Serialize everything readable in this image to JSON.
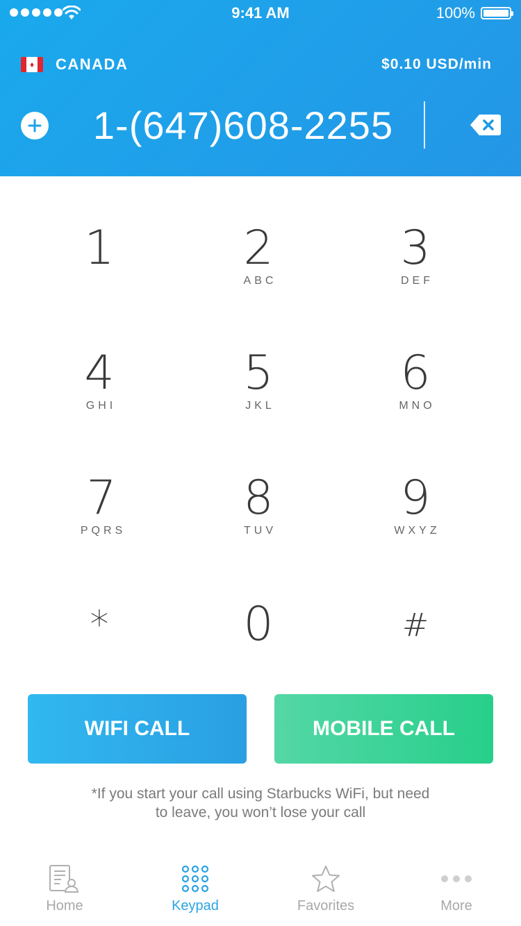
{
  "status_bar": {
    "time": "9:41 AM",
    "battery": "100%"
  },
  "header": {
    "country": "CANADA",
    "rate": "$0.10 USD/min",
    "phone_number": "1-(647)608-2255",
    "flag_icon": "canada-flag-icon",
    "add_icon": "plus-circle-icon",
    "backspace_icon": "backspace-icon",
    "colors": {
      "header_start": "#1aa9ec",
      "header_end": "#2496e6"
    }
  },
  "keypad": {
    "keys": [
      {
        "digit": "1",
        "letters": ""
      },
      {
        "digit": "2",
        "letters": "ABC"
      },
      {
        "digit": "3",
        "letters": "DEF"
      },
      {
        "digit": "4",
        "letters": "GHI"
      },
      {
        "digit": "5",
        "letters": "JKL"
      },
      {
        "digit": "6",
        "letters": "MNO"
      },
      {
        "digit": "7",
        "letters": "PQRS"
      },
      {
        "digit": "8",
        "letters": "TUV"
      },
      {
        "digit": "9",
        "letters": "WXYZ"
      },
      {
        "digit": "*",
        "letters": ""
      },
      {
        "digit": "0",
        "letters": ""
      },
      {
        "digit": "#",
        "letters": ""
      }
    ]
  },
  "actions": {
    "wifi_call": "WIFI CALL",
    "mobile_call": "MOBILE CALL",
    "colors": {
      "wifi": "#2fb2ee",
      "mobile": "#3cd49a"
    }
  },
  "note_line1": "*If you start your call using Starbucks WiFi, but need",
  "note_line2": "to leave, you won’t lose your call",
  "tabs": [
    {
      "label": "Home",
      "icon": "contacts-icon",
      "active": false
    },
    {
      "label": "Keypad",
      "icon": "keypad-icon",
      "active": true
    },
    {
      "label": "Favorites",
      "icon": "star-icon",
      "active": false
    },
    {
      "label": "More",
      "icon": "more-dots-icon",
      "active": false
    }
  ],
  "active_color": "#2ba3e3"
}
